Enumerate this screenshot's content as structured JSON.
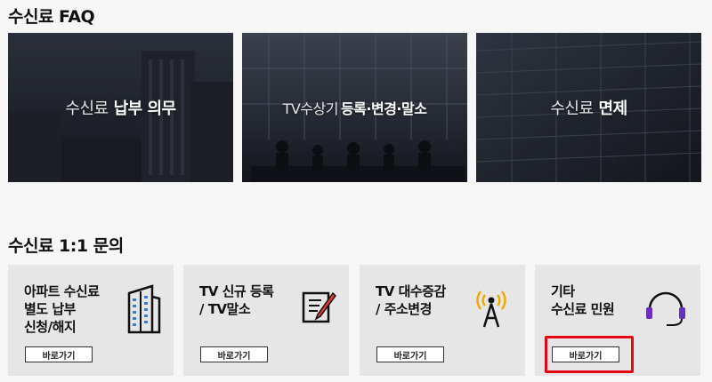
{
  "faq": {
    "title": "수신료 FAQ",
    "cards": [
      {
        "light": "수신료",
        "bold": "납부 의무"
      },
      {
        "light": "TV수상기",
        "bold": "등록·변경·말소"
      },
      {
        "light": "수신료",
        "bold": "면제"
      }
    ]
  },
  "inquiry": {
    "title": "수신료 1:1 문의",
    "cards": [
      {
        "lines": [
          "아파트 수신료",
          "별도 납부",
          "신청/해지"
        ],
        "button": "바로가기",
        "icon": "building-icon"
      },
      {
        "lines": [
          "TV 신규 등록",
          "/ TV말소"
        ],
        "button": "바로가기",
        "icon": "document-pen-icon"
      },
      {
        "lines": [
          "TV 대수증감",
          "/ 주소변경"
        ],
        "button": "바로가기",
        "icon": "antenna-icon"
      },
      {
        "lines": [
          "기타",
          "수신료 민원"
        ],
        "button": "바로가기",
        "icon": "headset-icon"
      }
    ]
  },
  "colors": {
    "highlight": "#e30613",
    "icon_accent_purple": "#6b2fbf",
    "icon_accent_orange": "#f2a900",
    "icon_accent_blue": "#3a7bd5",
    "icon_accent_red": "#e53935"
  }
}
